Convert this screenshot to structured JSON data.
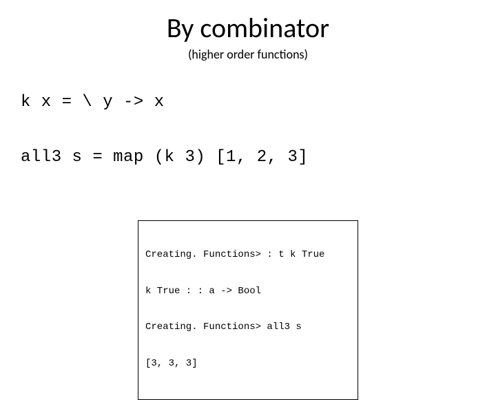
{
  "title": "By combinator",
  "subtitle": "(higher order functions)",
  "code": {
    "line1": "k x = \\ y -> x",
    "line2": "all3 s = map (k 3) [1, 2, 3]"
  },
  "repl": {
    "line1": "Creating. Functions> : t k True",
    "line2": "k True : : a -> Bool",
    "line3": "Creating. Functions> all3 s",
    "line4": "[3, 3, 3]"
  }
}
